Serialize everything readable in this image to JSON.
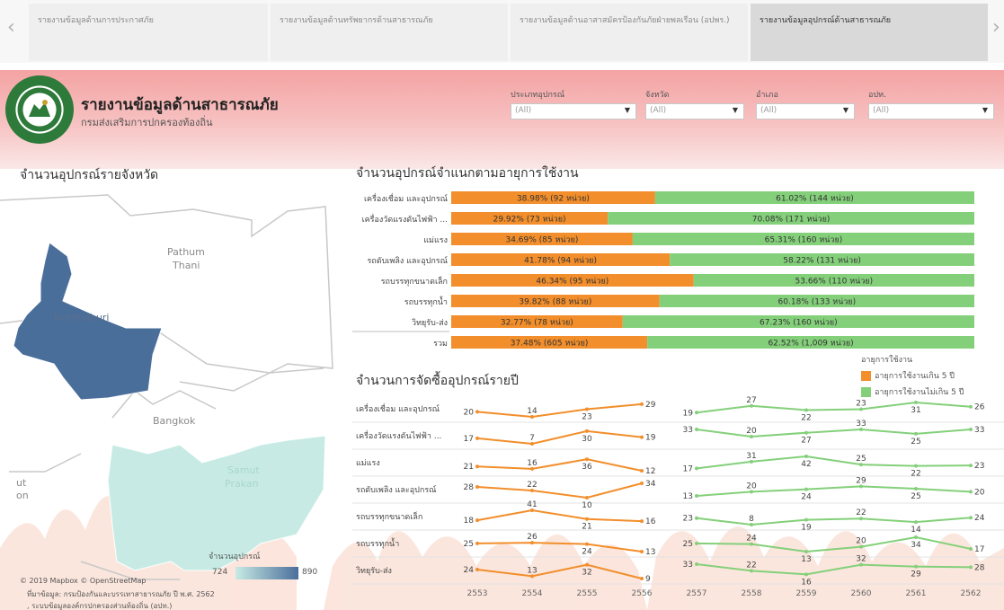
{
  "tabs": [
    {
      "label": "รายงานข้อมูลด้านการประกาศภัย"
    },
    {
      "label": "รายงานข้อมูลด้านทรัพยากรด้านสาธารณภัย"
    },
    {
      "label": "รายงานข้อมูลด้านอาสาสมัครป้องกันภัยฝ่ายพลเรือน (อปพร.)"
    },
    {
      "label": "รายงานข้อมูลอุปกรณ์ด้านสาธารณภัย"
    }
  ],
  "header": {
    "title": "รายงานข้อมูลด้านสาธารณภัย",
    "subtitle": "กรมส่งเสริมการปกครองท้องถิ่น"
  },
  "filters": [
    {
      "label": "ประเภทอุปกรณ์",
      "value": "(All)"
    },
    {
      "label": "จังหวัด",
      "value": "(All)"
    },
    {
      "label": "อำเภอ",
      "value": "(All)"
    },
    {
      "label": "อปท.",
      "value": "(All)"
    }
  ],
  "map": {
    "title": "จำนวนอุปกรณ์รายจังหวัด",
    "labels": {
      "pathum1": "Pathum",
      "pathum2": "Thani",
      "nonthaburi": "Nonthaburi",
      "bangkok": "Bangkok",
      "samut1": "Samut",
      "samut2": "Prakan",
      "edge1": "ut",
      "edge2": "on"
    },
    "legend": {
      "title": "จำนวนอุปกรณ์",
      "min": "724",
      "max": "890"
    },
    "attribution": "© 2019 Mapbox © OpenStreetMap",
    "source_line1": "ที่มาข้อมูล: กรมป้องกันและบรรเทาสาธารณภัย ปี พ.ศ. 2562",
    "source_line2": ", ระบบข้อมูลองค์กรปกครองส่วนท้องถิ่น (อปท.)",
    "colors": {
      "nonthaburi": "#4a6e9a",
      "samut_prakan": "#c7ebe4"
    }
  },
  "age_chart": {
    "title": "จำนวนอุปกรณ์จำแนกตามอายุการใช้งาน",
    "rows": [
      {
        "label": "เครื่องเชื่อม และอุปกรณ์",
        "over_pct": "38.98%",
        "over_units": "(92 หน่วย)",
        "under_pct": "61.02%",
        "under_units": "(144 หน่วย)",
        "over": 38.98
      },
      {
        "label": "เครื่องวัดแรงดันไฟฟ้า ...",
        "over_pct": "29.92%",
        "over_units": "(73 หน่วย)",
        "under_pct": "70.08%",
        "under_units": "(171 หน่วย)",
        "over": 29.92
      },
      {
        "label": "แม่แรง",
        "over_pct": "34.69%",
        "over_units": "(85 หน่วย)",
        "under_pct": "65.31%",
        "under_units": "(160 หน่วย)",
        "over": 34.69
      },
      {
        "label": "รถดับเพลิง และอุปกรณ์",
        "over_pct": "41.78%",
        "over_units": "(94 หน่วย)",
        "under_pct": "58.22%",
        "under_units": "(131 หน่วย)",
        "over": 41.78
      },
      {
        "label": "รถบรรทุกขนาดเล็ก",
        "over_pct": "46.34%",
        "over_units": "(95 หน่วย)",
        "under_pct": "53.66%",
        "under_units": "(110 หน่วย)",
        "over": 46.34
      },
      {
        "label": "รถบรรทุกน้ำ",
        "over_pct": "39.82%",
        "over_units": "(88 หน่วย)",
        "under_pct": "60.18%",
        "under_units": "(133 หน่วย)",
        "over": 39.82
      },
      {
        "label": "วิทยุรับ-ส่ง",
        "over_pct": "32.77%",
        "over_units": "(78 หน่วย)",
        "under_pct": "67.23%",
        "under_units": "(160 หน่วย)",
        "over": 32.77
      },
      {
        "label": "รวม",
        "over_pct": "37.48%",
        "over_units": "(605 หน่วย)",
        "under_pct": "62.52%",
        "under_units": "(1,009 หน่วย)",
        "over": 37.48
      }
    ],
    "colors": {
      "over": "#f28e2b",
      "under": "#84d07a"
    }
  },
  "legend": {
    "title": "อายุการใช้งาน",
    "over": "อายุการใช้งานเกิน 5 ปี",
    "under": "อายุการใช้งานไม่เกิน 5 ปี"
  },
  "chart_data": {
    "type": "line",
    "title": "จำนวนการจัดซื้ออุปกรณ์รายปี",
    "x": [
      "2553",
      "2554",
      "2555",
      "2556",
      "2557",
      "2558",
      "2559",
      "2560",
      "2561",
      "2562"
    ],
    "rows": [
      {
        "label": "เครื่องเชื่อม และอุปกรณ์",
        "values": [
          20,
          14,
          23,
          29,
          19,
          27,
          22,
          23,
          31,
          26
        ]
      },
      {
        "label": "เครื่องวัดแรงดันไฟฟ้า ...",
        "values": [
          17,
          7,
          30,
          19,
          33,
          20,
          27,
          33,
          25,
          33
        ]
      },
      {
        "label": "แม่แรง",
        "values": [
          21,
          16,
          36,
          12,
          17,
          31,
          42,
          25,
          22,
          23
        ]
      },
      {
        "label": "รถดับเพลิง และอุปกรณ์",
        "values": [
          28,
          22,
          10,
          34,
          13,
          20,
          24,
          29,
          25,
          20
        ]
      },
      {
        "label": "รถบรรทุกขนาดเล็ก",
        "values": [
          18,
          41,
          21,
          16,
          23,
          8,
          19,
          22,
          14,
          24
        ]
      },
      {
        "label": "รถบรรทุกน้ำ",
        "values": [
          25,
          26,
          24,
          13,
          25,
          24,
          13,
          20,
          34,
          17
        ]
      },
      {
        "label": "วิทยุรับ-ส่ง",
        "values": [
          24,
          13,
          32,
          9,
          33,
          22,
          16,
          32,
          29,
          28
        ]
      }
    ],
    "series": [
      {
        "name": "อายุการใช้งานเกิน 5 ปี",
        "years": [
          "2553",
          "2554",
          "2555",
          "2556"
        ],
        "color": "#f28e2b"
      },
      {
        "name": "อายุการใช้งานไม่เกิน 5 ปี",
        "years": [
          "2557",
          "2558",
          "2559",
          "2560",
          "2561",
          "2562"
        ],
        "color": "#84d07a"
      }
    ]
  }
}
